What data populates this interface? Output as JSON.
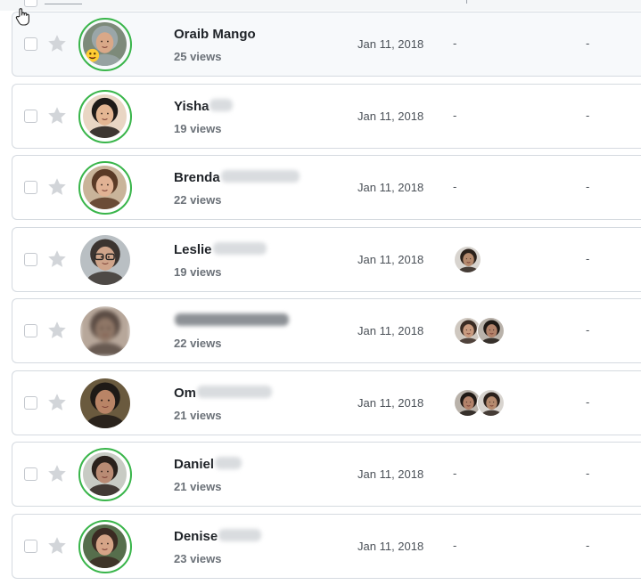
{
  "theme": {
    "ring_color": "#39b54a",
    "star_color": "#d2d5d9",
    "border_color": "#d5dae0"
  },
  "rows": [
    {
      "name": "Oraib Mango",
      "name_blurred": false,
      "views": "25 views",
      "date": "Jan 11, 2018",
      "col_a": "-",
      "col_b": "-",
      "viewer_count": 0,
      "ring": true,
      "avatar": "avatar-hijab-emoji"
    },
    {
      "name": "Yisha",
      "name_blurred": true,
      "views": "19 views",
      "date": "Jan 11, 2018",
      "col_a": "-",
      "col_b": "-",
      "viewer_count": 0,
      "ring": true,
      "avatar": "avatar-dark-hair"
    },
    {
      "name": "Brenda",
      "name_blurred": true,
      "views": "22 views",
      "date": "Jan 11, 2018",
      "col_a": "-",
      "col_b": "-",
      "viewer_count": 0,
      "ring": true,
      "avatar": "avatar-brown-hair"
    },
    {
      "name": "Leslie",
      "name_blurred": true,
      "views": "19 views",
      "date": "Jan 11, 2018",
      "col_a": "",
      "col_b": "-",
      "viewer_count": 1,
      "ring": false,
      "avatar": "avatar-glasses"
    },
    {
      "name": "",
      "name_blurred": true,
      "views": "22 views",
      "date": "Jan 11, 2018",
      "col_a": "",
      "col_b": "-",
      "viewer_count": 2,
      "ring": false,
      "avatar": "avatar-blurred"
    },
    {
      "name": "Om",
      "name_blurred": true,
      "views": "21 views",
      "date": "Jan 11, 2018",
      "col_a": "",
      "col_b": "-",
      "viewer_count": 2,
      "ring": false,
      "avatar": "avatar-smile"
    },
    {
      "name": "Daniel",
      "name_blurred": true,
      "views": "21 views",
      "date": "Jan 11, 2018",
      "col_a": "-",
      "col_b": "-",
      "viewer_count": 0,
      "ring": true,
      "avatar": "avatar-short-hair"
    },
    {
      "name": "Denise",
      "name_blurred": true,
      "views": "23 views",
      "date": "Jan 11, 2018",
      "col_a": "-",
      "col_b": "-",
      "viewer_count": 0,
      "ring": true,
      "avatar": "avatar-long-hair"
    }
  ]
}
